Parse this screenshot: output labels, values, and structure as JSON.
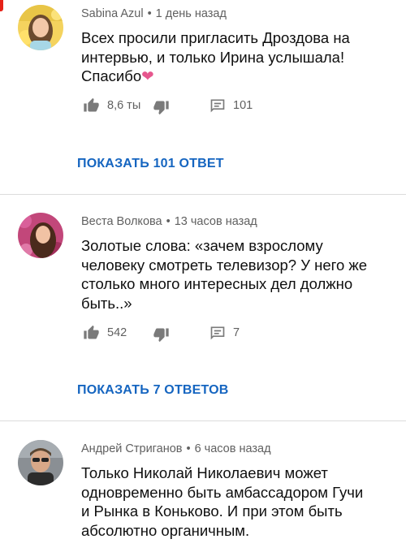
{
  "colors": {
    "link": "#1565c0",
    "meta": "#606060",
    "divider": "#dcdcdc",
    "heart": "#e6578e"
  },
  "comments": [
    {
      "author": "Sabina Azul",
      "time": "1 день назад",
      "text_lines": [
        "Всех просили пригласить Дроздова на",
        "интервью, и только Ирина услышала!",
        "Спасибо"
      ],
      "emoji": "❤",
      "likes": "8,6 ты",
      "replies": "101",
      "show_replies": "ПОКАЗАТЬ 101 ОТВЕТ"
    },
    {
      "author": "Веста Волкова",
      "time": "13 часов назад",
      "text_lines": [
        "Золотые слова: «зачем взрослому",
        "человеку смотреть телевизор? У него же",
        "столько много интересных дел должно",
        "быть..»"
      ],
      "likes": "542",
      "replies": "7",
      "show_replies": "ПОКАЗАТЬ 7 ОТВЕТОВ"
    },
    {
      "author": "Андрей Стриганов",
      "time": "6 часов назад",
      "text_lines": [
        "Только Николай Николаевич может",
        "одновременно быть амбассадором Гучи",
        "и Рынка в Коньково. И при этом быть",
        "абсолютно органичным."
      ]
    }
  ],
  "icons": {
    "like": "thumbs-up-icon",
    "dislike": "thumbs-down-icon",
    "reply": "comment-icon"
  },
  "separator": "•"
}
